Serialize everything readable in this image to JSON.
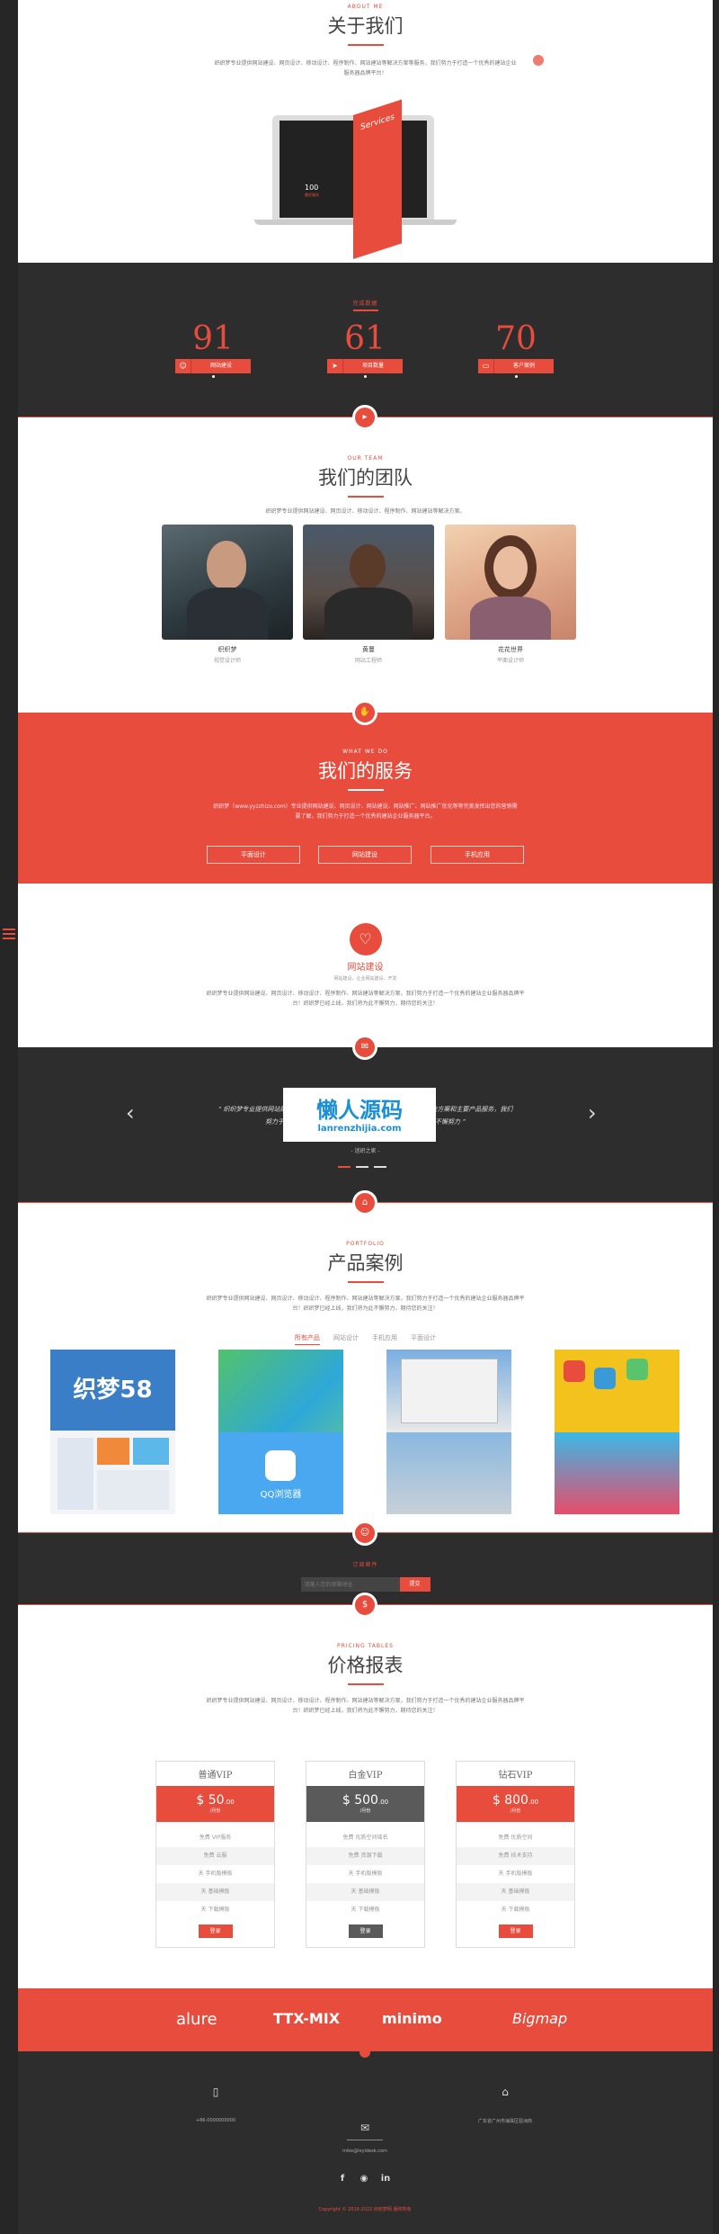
{
  "about": {
    "tag": "ABOUT ME",
    "title": "关于我们",
    "desc": "织织梦专业提供网站建设、网页设计、移动设计、程序制作、网站建站等解决方案等服务，我们努力于打造一个优秀的建站企业服务器品牌平台！",
    "book_title": "Services",
    "book_number": "100",
    "book_sub": "最优服务"
  },
  "stats": {
    "tag": "完成数据",
    "items": [
      {
        "number": "91",
        "label": "网站建设",
        "icon": "cat-icon"
      },
      {
        "number": "61",
        "label": "项目数量",
        "icon": "rocket-icon"
      },
      {
        "number": "70",
        "label": "客户案例",
        "icon": "monitor-icon"
      }
    ]
  },
  "team": {
    "tag": "OUR TEAM",
    "title": "我们的团队",
    "desc": "织织梦专业提供网站建设、网页设计、移动设计、程序制作、网站建站等解决方案。",
    "members": [
      {
        "name": "织织梦",
        "role": "视觉设计师"
      },
      {
        "name": "黄蔓",
        "role": "网站工程师"
      },
      {
        "name": "花花世界",
        "role": "平面设计师"
      }
    ]
  },
  "services": {
    "tag": "WHAT WE DO",
    "title": "我们的服务",
    "desc": "织织梦（www.yyzzhizo.com）专业提供网站建设、网页设计、网站建设、网站推广、网站推广优化等等完美发挥出您的营销需要了解，我们努力于打造一个优秀的建站企业服务器平台。",
    "buttons": [
      "平面设计",
      "网站建设",
      "手机应用"
    ]
  },
  "feature": {
    "title": "网站建设",
    "sub": "网站建设，企业网站建设，开发",
    "desc": "织织梦专业提供网站建设、网页设计、移动设计、程序制作、网站建站等解决方案，我们努力于打造一个优秀的建站企业服务器品牌平台！织织梦已经上线，我们将为此不懈努力，期待您的关注！"
  },
  "testimonial": {
    "quote": "“ 织织梦专业提供网站建设、网页设计、移动设计、程序制作、网站建站等解决方案和主要产品服务，我们努力于打造一个优秀的建站企业服务器品牌平台！我们将为此不懈努力 ”",
    "author": "- 迷织之家 -",
    "watermark_cn": "懒人源码",
    "watermark_url": "lanrenzhijia.com"
  },
  "portfolio": {
    "tag": "PORTFOLIO",
    "title": "产品案例",
    "desc": "织织梦专业提供网站建设、网页设计、移动设计、程序制作、网站建站等解决方案，我们努力于打造一个优秀的建站企业服务器品牌平台！织织梦已经上线，我们将为此不懈努力，期待您的关注！",
    "tabs": [
      "所有产品",
      "网站设计",
      "手机应用",
      "平面设计"
    ],
    "case1_text": "织梦58",
    "case2_text": "QQ浏览器"
  },
  "subscribe": {
    "tag": "订阅邮件",
    "placeholder": "请输入您的邮箱地址",
    "button": "提交"
  },
  "pricing": {
    "tag": "PRICING TABLES",
    "title": "价格报表",
    "desc": "织织梦专业提供网站建设、网页设计、移动设计、程序制作、网站建站等解决方案，我们努力于打造一个优秀的建站企业服务器品牌平台！织织梦已经上线，我们将为此不懈努力，期待您的关注！",
    "plans": [
      {
        "name": "普通VIP",
        "price": "50",
        "cents": ".00",
        "per": "/月份",
        "features": [
          "免费 VIP服务",
          "免费 云服",
          "天 手机版模板",
          "天 基础模板",
          "天 下载模板"
        ],
        "cta": "登录"
      },
      {
        "name": "白金VIP",
        "price": "500",
        "cents": ".00",
        "per": "/月份",
        "features": [
          "免费 优质空间域名",
          "免费 资源下载",
          "天 手机版模板",
          "天 基础模板",
          "天 下载模板"
        ],
        "cta": "登录"
      },
      {
        "name": "钻石VIP",
        "price": "800",
        "cents": ".00",
        "per": "/月份",
        "features": [
          "免费 优质空间",
          "免费 技术支持",
          "天 手机版模板",
          "天 基础模板",
          "天 下载模板"
        ],
        "cta": "登录"
      }
    ]
  },
  "partners": [
    "alure",
    "TTX-MIX",
    "minimo",
    "Bigmap"
  ],
  "footer": {
    "phone": "+86-0000000000",
    "address": "广东省广州市海珠区琶洲商",
    "email": "mike@leyidesk.com",
    "copyright": "Copyright © 2016-2022 织织梦网 版权所有"
  },
  "colors": {
    "accent": "#e84c3d",
    "dark": "#2d2d2d",
    "gray_plan": "#5a5a5a"
  }
}
